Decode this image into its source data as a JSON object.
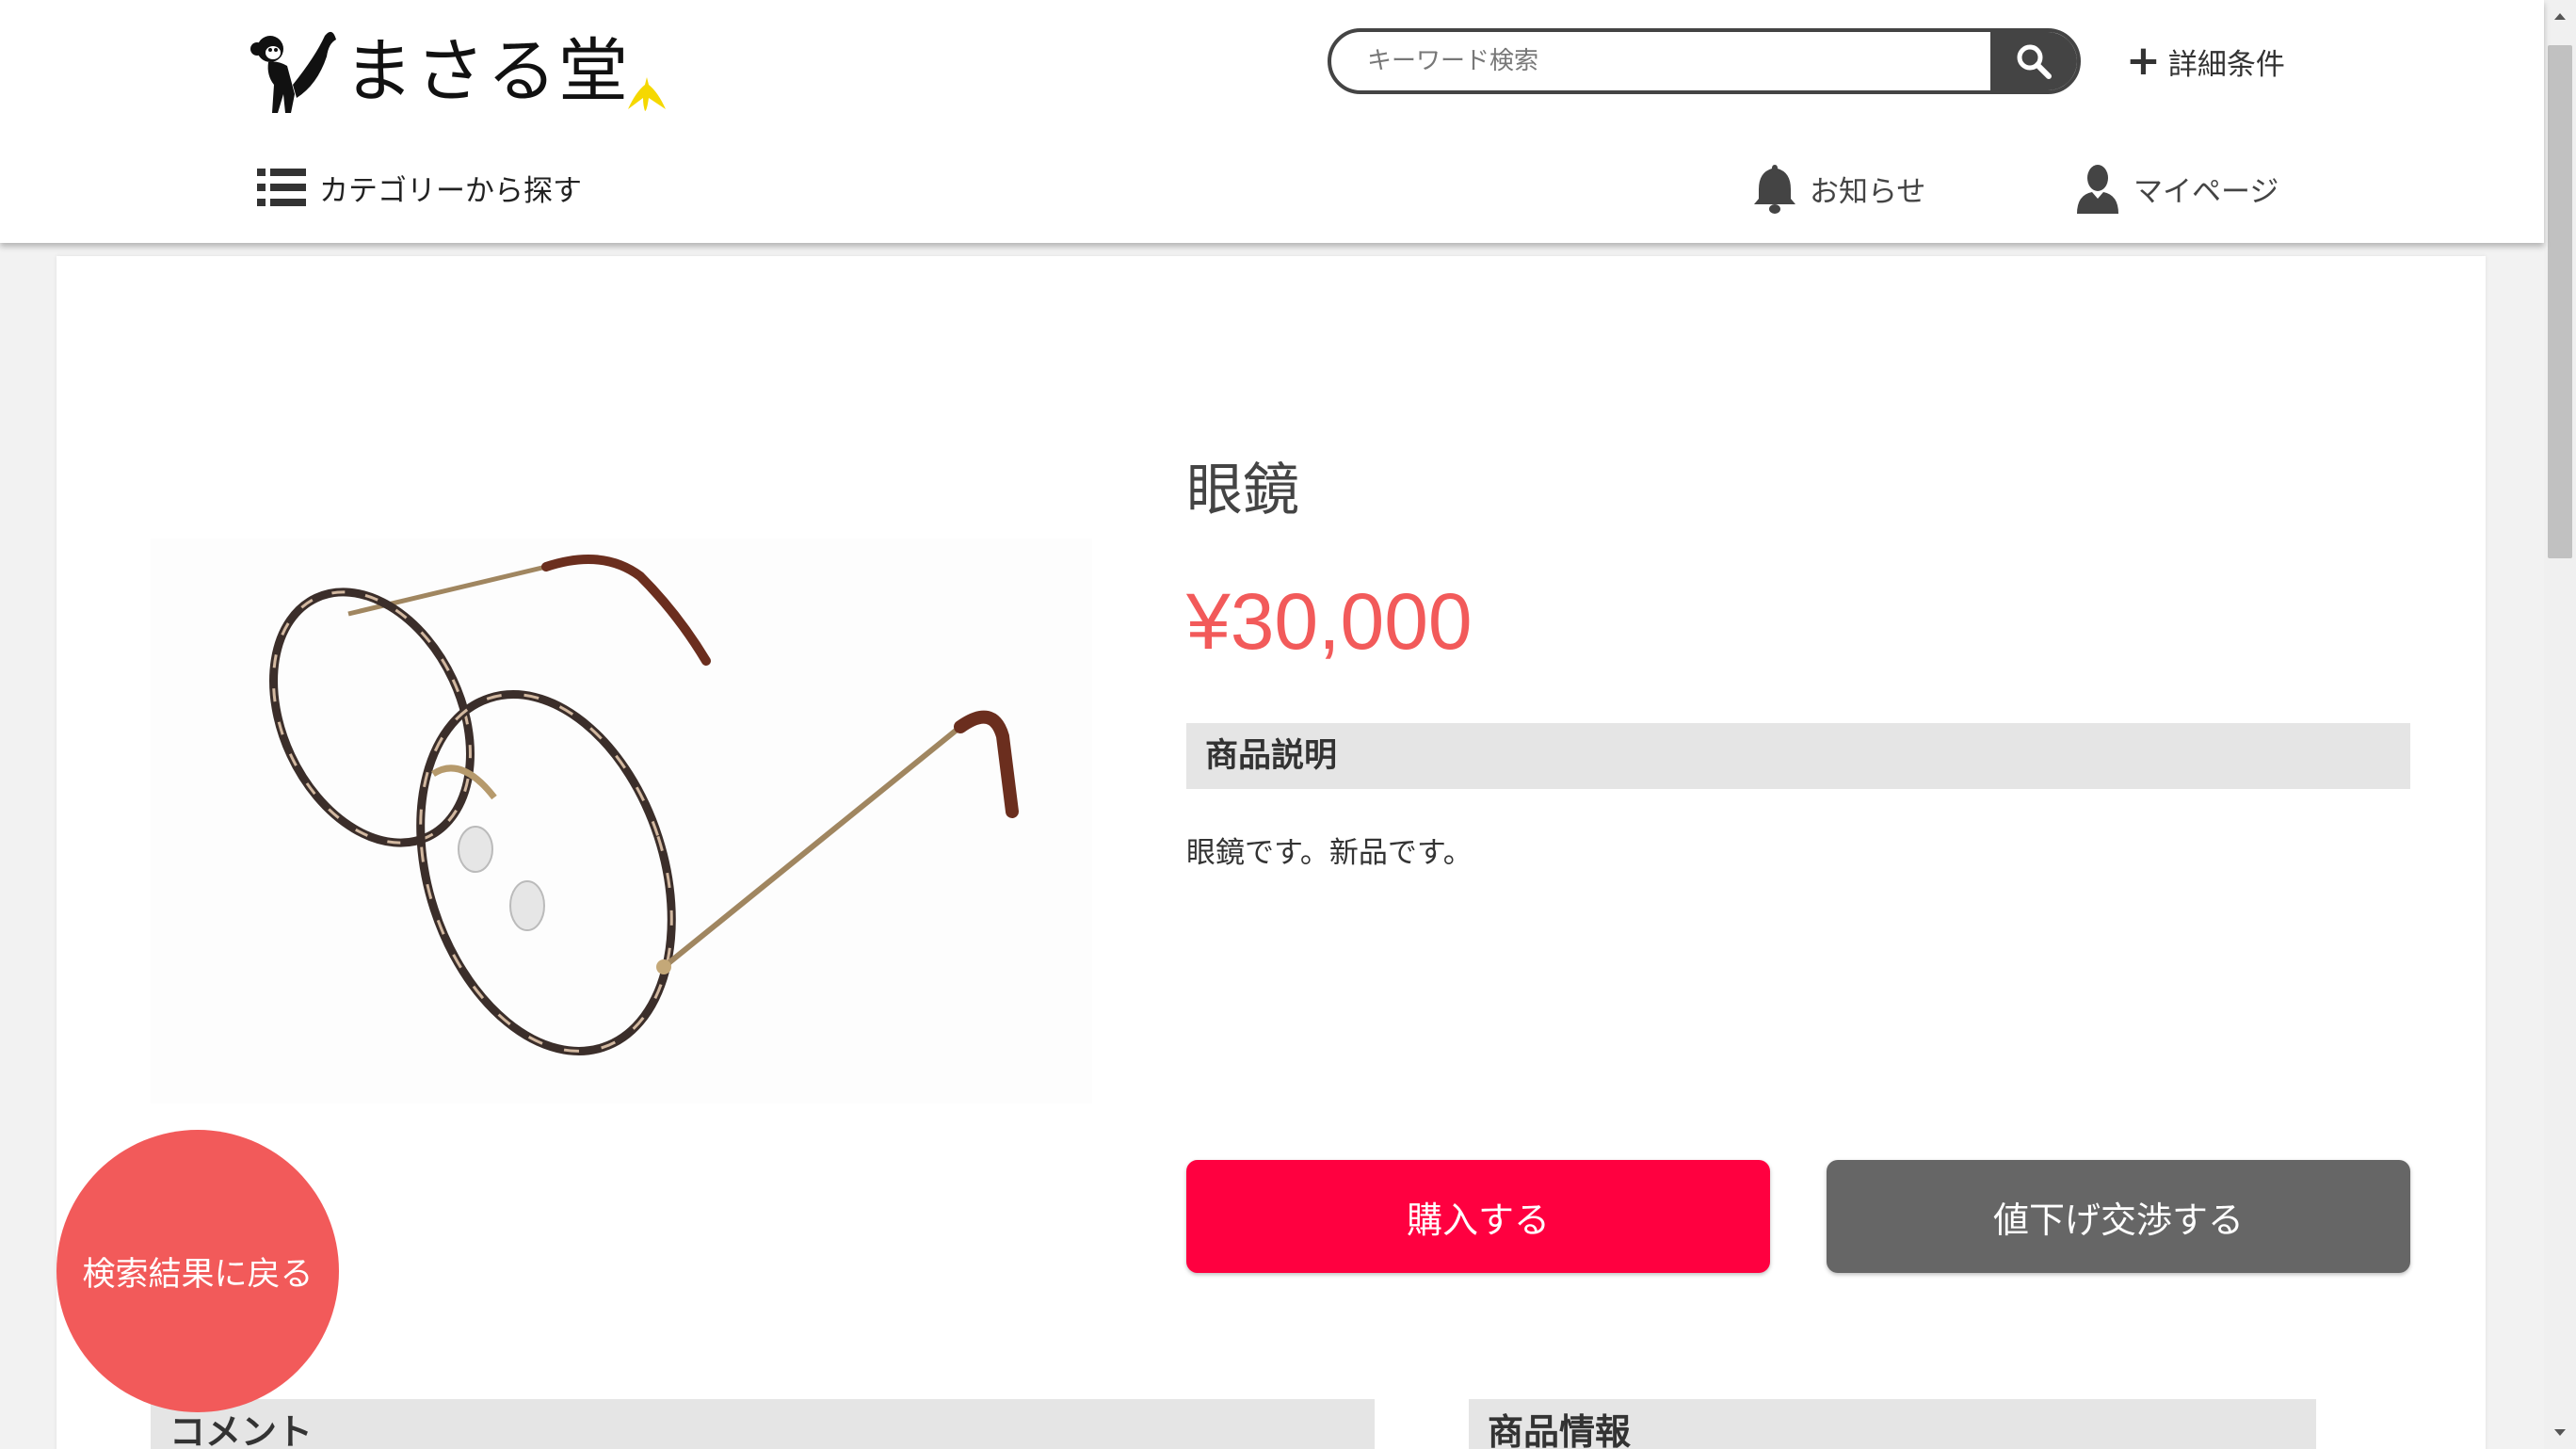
{
  "header": {
    "logo_text": "まさる堂",
    "search_placeholder": "キーワード検索",
    "detail_conditions_label": "詳細条件",
    "category_label": "カテゴリーから探す",
    "notice_label": "お知らせ",
    "mypage_label": "マイページ"
  },
  "product": {
    "title": "眼鏡",
    "price": "¥30,000",
    "description_header": "商品説明",
    "description_text": "眼鏡です。新品です。",
    "buy_label": "購入する",
    "negotiate_label": "値下げ交渉する"
  },
  "sections": {
    "comment_header": "コメント",
    "info_header": "商品情報"
  },
  "back_button_label": "検索結果に戻る",
  "colors": {
    "price": "#f25a5a",
    "buy_button": "#ff0040",
    "negotiate_button": "#666666",
    "back_button": "#f25a5a",
    "section_header_bg": "#e5e5e5",
    "search_button": "#444444"
  },
  "icons": [
    "monkey-logo-icon",
    "banana-icon",
    "search-icon",
    "plus-icon",
    "list-icon",
    "bell-icon",
    "user-icon",
    "glasses-product-image"
  ]
}
